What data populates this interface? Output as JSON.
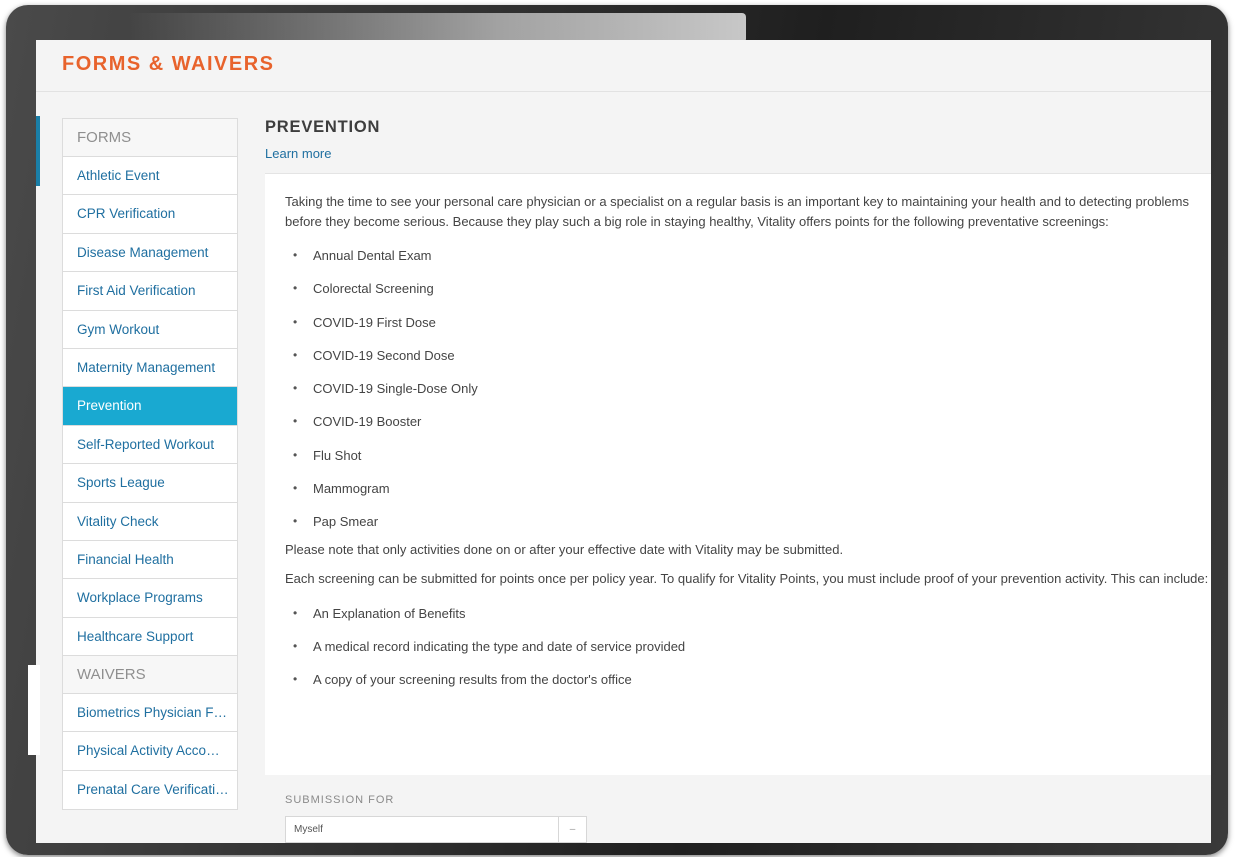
{
  "header": {
    "title": "FORMS & WAIVERS"
  },
  "sidebar": {
    "forms_heading": "FORMS",
    "forms": [
      "Athletic Event",
      "CPR Verification",
      "Disease Management",
      "First Aid Verification",
      "Gym Workout",
      "Maternity Management",
      "Prevention",
      "Self-Reported Workout",
      "Sports League",
      "Vitality Check",
      "Financial Health",
      "Workplace Programs",
      "Healthcare Support"
    ],
    "active_item": "Prevention",
    "waivers_heading": "WAIVERS",
    "waivers": [
      "Biometrics Physician Form",
      "Physical Activity Accommodation",
      "Prenatal Care Verification"
    ]
  },
  "main": {
    "title": "PREVENTION",
    "learn_more": "Learn more",
    "intro": "Taking the time to see your personal care physician or a specialist on a regular basis is an important key to maintaining your health and to detecting problems before they become serious. Because they play such a big role in staying healthy, Vitality offers points for the following preventative screenings:",
    "screenings": [
      "Annual Dental Exam",
      "Colorectal Screening",
      "COVID-19 First Dose",
      "COVID-19 Second Dose",
      "COVID-19 Single-Dose Only",
      "COVID-19 Booster",
      "Flu Shot",
      "Mammogram",
      "Pap Smear"
    ],
    "note": "Please note that only activities done on or after your effective date with Vitality may be submitted.",
    "proof_text": "Each screening can be submitted for points once per policy year. To qualify for Vitality Points, you must include proof of your prevention activity. This can include:",
    "proof_items": [
      "An Explanation of Benefits",
      "A medical record indicating the type and date of service provided",
      "A copy of your screening results from the doctor's office"
    ],
    "submission_label": "SUBMISSION FOR",
    "submission_value": "Myself"
  },
  "icons": {
    "select_arrow": "chevron-down-icon"
  },
  "colors": {
    "brand_orange": "#e8632c",
    "active_blue": "#19a9d1",
    "link_blue": "#1f6fa0"
  }
}
